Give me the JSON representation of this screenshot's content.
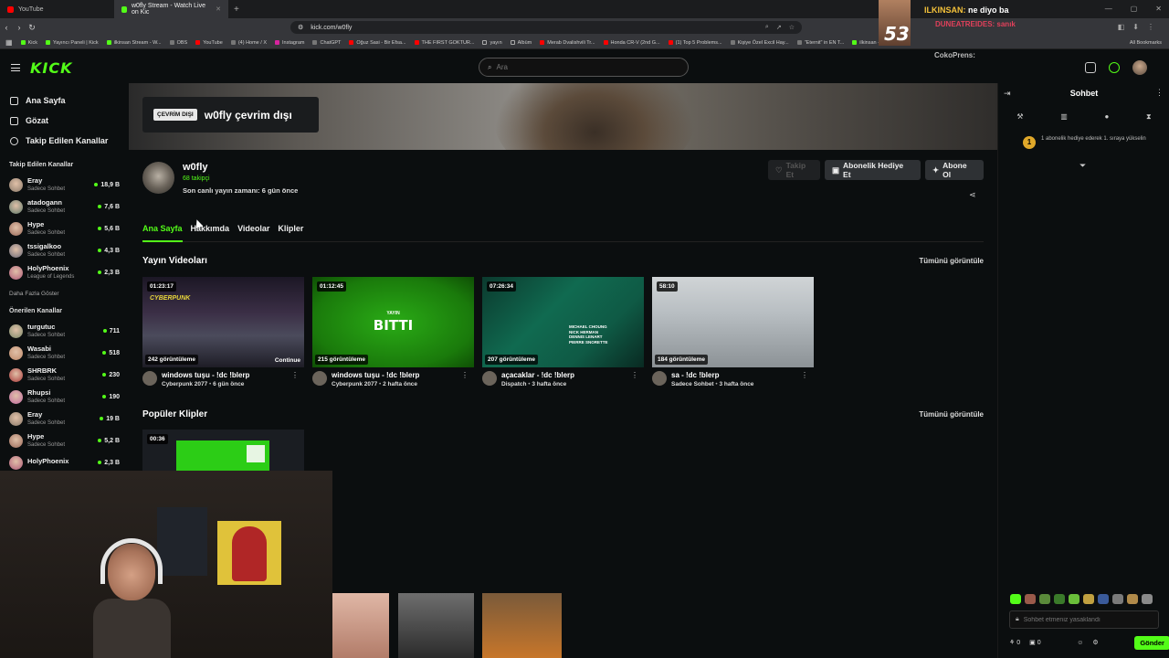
{
  "browser": {
    "tabs": [
      {
        "title": "YouTube",
        "active": false
      },
      {
        "title": "w0fly Stream - Watch Live on Kic",
        "active": true
      }
    ],
    "url": "kick.com/w0fly",
    "bookmarks": [
      "Kick",
      "Yayıncı Paneli | Kick",
      "ilkinsan Stream - W...",
      "OBS",
      "YouTube",
      "(4) Home / X",
      "Instagram",
      "ChatGPT",
      "Oğuz Sasi - Bir Efsa...",
      "THE FIRST GOKTUR...",
      "yayın",
      "Albüm",
      "Merab Dvalishvili Tr...",
      "Honda CR-V (2nd G...",
      "(1) Top 5 Problems...",
      "Kişiye Özel Excil Hay...",
      "\"Eternit\" in EN T...",
      "ilkinsan - Watch clip..."
    ],
    "all_bookmarks": "All Bookmarks"
  },
  "kick": {
    "logo": "KICK",
    "search_placeholder": "Ara"
  },
  "sidebar": {
    "nav": [
      {
        "label": "Ana Sayfa",
        "icon": "home-icon"
      },
      {
        "label": "Gözat",
        "icon": "browse-icon"
      },
      {
        "label": "Takip Edilen Kanallar",
        "icon": "heart-icon"
      }
    ],
    "followed_heading": "Takip Edilen Kanallar",
    "followed": [
      {
        "name": "Eray",
        "sub": "Sadece Sohbet",
        "count": "18,9 B",
        "color": "#8a7a6a"
      },
      {
        "name": "atadogann",
        "sub": "Sadece Sohbet",
        "count": "7,6 B",
        "color": "#5f7a6a"
      },
      {
        "name": "Hype",
        "sub": "Sadece Sohbet",
        "count": "5,6 B",
        "color": "#9a6a5a"
      },
      {
        "name": "tssigalkoo",
        "sub": "Sadece Sohbet",
        "count": "4,3 B",
        "color": "#6a6a7a"
      },
      {
        "name": "HolyPhoenix",
        "sub": "League of Legends",
        "count": "2,3 B",
        "color": "#b05a7a"
      }
    ],
    "more": "Daha Fazla Göster",
    "recommended_heading": "Önerilen Kanallar",
    "recommended": [
      {
        "name": "turgutuc",
        "sub": "Sadece Sohbet",
        "count": "711",
        "color": "#7a8a6a"
      },
      {
        "name": "Wasabi",
        "sub": "Sadece Sohbet",
        "count": "518",
        "color": "#c08a6a"
      },
      {
        "name": "SHRBRK",
        "sub": "Sadece Sohbet",
        "count": "230",
        "color": "#aa3a3a"
      },
      {
        "name": "Rhupsi",
        "sub": "Sadece Sohbet",
        "count": "190",
        "color": "#c06aa0"
      },
      {
        "name": "Eray",
        "sub": "Sadece Sohbet",
        "count": "19 B",
        "color": "#8a7a6a"
      },
      {
        "name": "Hype",
        "sub": "Sadece Sohbet",
        "count": "5,2 B",
        "color": "#9a6a5a"
      },
      {
        "name": "HolyPhoenix",
        "sub": "",
        "count": "2,3 B",
        "color": "#b05a7a"
      }
    ]
  },
  "channel": {
    "offline_badge": "ÇEVRİM DIŞI",
    "offline_title": "w0fly çevrim dışı",
    "name": "w0fly",
    "followers": "68 takipçi",
    "last_stream": "Son canlı yayın zamanı: 6 gün önce",
    "follow_label": "Takip Et",
    "gift_label": "Abonelik Hediye Et",
    "subscribe_label": "Abone Ol",
    "tabs": [
      "Ana Sayfa",
      "Hakkımda",
      "Videolar",
      "Klipler"
    ],
    "active_tab": "Ana Sayfa",
    "videos_heading": "Yayın Videoları",
    "see_all": "Tümünü görüntüle",
    "clips_heading": "Popüler Klipler",
    "clips_see_all": "Tümünü görüntüle",
    "videos": [
      {
        "duration": "01:23:17",
        "views": "242 görüntüleme",
        "title": "windows tuşu - !dc !blerp",
        "category": "Cyberpunk 2077",
        "ago": "6 gün önce",
        "continue": "Continue",
        "thumb_text": "CYBERPUNK"
      },
      {
        "duration": "01:12:45",
        "views": "215 görüntüleme",
        "title": "windows tuşu - !dc !blerp",
        "category": "Cyberpunk 2077",
        "ago": "2 hafta önce",
        "thumb_small": "YAYIN",
        "thumb_text": "BITTI"
      },
      {
        "duration": "07:26:34",
        "views": "207 görüntüleme",
        "title": "açacaklar - !dc !blerp",
        "category": "Dispatch",
        "ago": "3 hafta önce",
        "thumb_text": "MICHAEL CHOUNG\nNICK HERMAN\nDENNIS LENART\nPIERRE SNORETTE"
      },
      {
        "duration": "58:10",
        "views": "184 görüntüleme",
        "title": "sa - !dc !blerp",
        "category": "Sadece Sohbet",
        "ago": "3 hafta önce"
      }
    ],
    "clip": {
      "duration": "00:36"
    }
  },
  "chat": {
    "title": "Sohbet",
    "gift_rank": "1",
    "gift_text": "1 abonelik hediye ederek 1. sıraya yükselin",
    "input_placeholder": "Sohbet etmeniz yasaklandı",
    "send_label": "Gönder",
    "counts": [
      "0",
      "0"
    ]
  },
  "overlay": {
    "number": "53",
    "alert_name": "ILKINSAN:",
    "alert_text": "ne diyo ba",
    "alert_line2": "DUNEATREIDES: sanık",
    "alert_line3": "CokoPrens:"
  },
  "colors": {
    "accent": "#53fc18",
    "background": "#0b0e0f"
  }
}
